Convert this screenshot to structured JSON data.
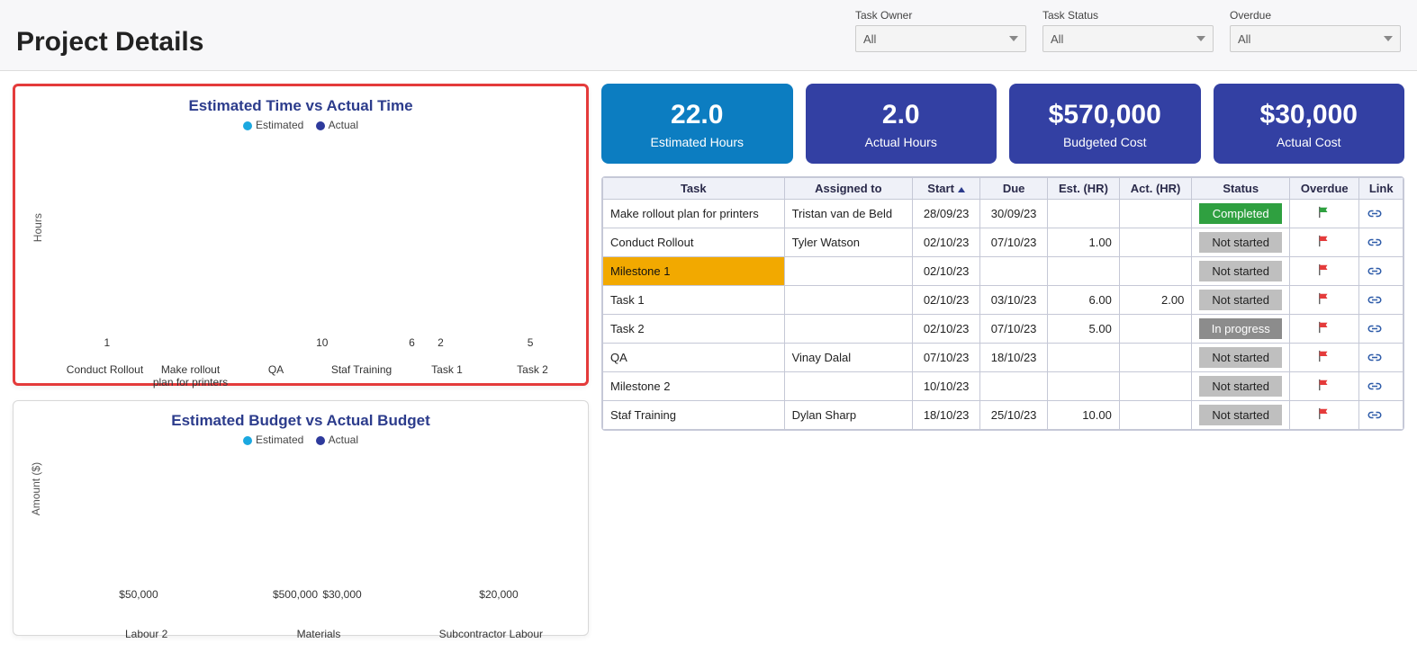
{
  "header": {
    "title": "Project Details"
  },
  "filters": [
    {
      "label": "Task Owner",
      "value": "All"
    },
    {
      "label": "Task Status",
      "value": "All"
    },
    {
      "label": "Overdue",
      "value": "All"
    }
  ],
  "kpis": [
    {
      "value": "22.0",
      "label": "Estimated Hours",
      "color": "blue"
    },
    {
      "value": "2.0",
      "label": "Actual Hours",
      "color": "indigo"
    },
    {
      "value": "$570,000",
      "label": "Budgeted Cost",
      "color": "indigo"
    },
    {
      "value": "$30,000",
      "label": "Actual Cost",
      "color": "indigo"
    }
  ],
  "table": {
    "columns": [
      "Task",
      "Assigned to",
      "Start",
      "Due",
      "Est. (HR)",
      "Act. (HR)",
      "Status",
      "Overdue",
      "Link"
    ],
    "sort_column": "Start",
    "rows": [
      {
        "task": "Make rollout plan for printers",
        "assigned": "Tristan van de Beld",
        "start": "28/09/23",
        "due": "30/09/23",
        "est": "",
        "act": "",
        "status": "Completed",
        "flag": "green",
        "milestone": false
      },
      {
        "task": "Conduct Rollout",
        "assigned": "Tyler Watson",
        "start": "02/10/23",
        "due": "07/10/23",
        "est": "1.00",
        "act": "",
        "status": "Not started",
        "flag": "red",
        "milestone": false
      },
      {
        "task": "Milestone 1",
        "assigned": "",
        "start": "02/10/23",
        "due": "",
        "est": "",
        "act": "",
        "status": "Not started",
        "flag": "red",
        "milestone": true
      },
      {
        "task": "Task 1",
        "assigned": "",
        "start": "02/10/23",
        "due": "03/10/23",
        "est": "6.00",
        "act": "2.00",
        "status": "Not started",
        "flag": "red",
        "milestone": false
      },
      {
        "task": "Task 2",
        "assigned": "",
        "start": "02/10/23",
        "due": "07/10/23",
        "est": "5.00",
        "act": "",
        "status": "In progress",
        "flag": "red",
        "milestone": false
      },
      {
        "task": "QA",
        "assigned": "Vinay Dalal",
        "start": "07/10/23",
        "due": "18/10/23",
        "est": "",
        "act": "",
        "status": "Not started",
        "flag": "red",
        "milestone": false
      },
      {
        "task": "Milestone 2",
        "assigned": "",
        "start": "10/10/23",
        "due": "",
        "est": "",
        "act": "",
        "status": "Not started",
        "flag": "red",
        "milestone": false
      },
      {
        "task": "Staf Training",
        "assigned": "Dylan Sharp",
        "start": "18/10/23",
        "due": "25/10/23",
        "est": "10.00",
        "act": "",
        "status": "Not started",
        "flag": "red",
        "milestone": false
      }
    ]
  },
  "chart1": {
    "title": "Estimated Time vs Actual Time",
    "legend": {
      "estimated": "Estimated",
      "actual": "Actual"
    },
    "ylabel": "Hours"
  },
  "chart2": {
    "title": "Estimated Budget vs Actual Budget",
    "legend": {
      "estimated": "Estimated",
      "actual": "Actual"
    },
    "ylabel": "Amount ($)"
  },
  "chart_data": [
    {
      "type": "bar",
      "title": "Estimated Time vs Actual Time",
      "ylabel": "Hours",
      "categories": [
        "Conduct Rollout",
        "Make rollout plan for printers",
        "QA",
        "Staf Training",
        "Task 1",
        "Task 2"
      ],
      "series": [
        {
          "name": "Estimated",
          "values": [
            1,
            null,
            null,
            10,
            6,
            5
          ]
        },
        {
          "name": "Actual",
          "values": [
            null,
            null,
            null,
            null,
            2,
            null
          ]
        }
      ],
      "ylim": [
        0,
        10
      ]
    },
    {
      "type": "bar",
      "title": "Estimated Budget vs Actual Budget",
      "ylabel": "Amount ($)",
      "categories": [
        "Labour 2",
        "Materials",
        "Subcontractor Labour"
      ],
      "series": [
        {
          "name": "Estimated",
          "values": [
            50000,
            500000,
            20000
          ]
        },
        {
          "name": "Actual",
          "values": [
            null,
            30000,
            null
          ]
        }
      ],
      "value_labels": [
        {
          "Estimated": "$50,000",
          "Actual": ""
        },
        {
          "Estimated": "$500,000",
          "Actual": "$30,000"
        },
        {
          "Estimated": "$20,000",
          "Actual": ""
        }
      ],
      "ylim": [
        0,
        500000
      ]
    }
  ]
}
